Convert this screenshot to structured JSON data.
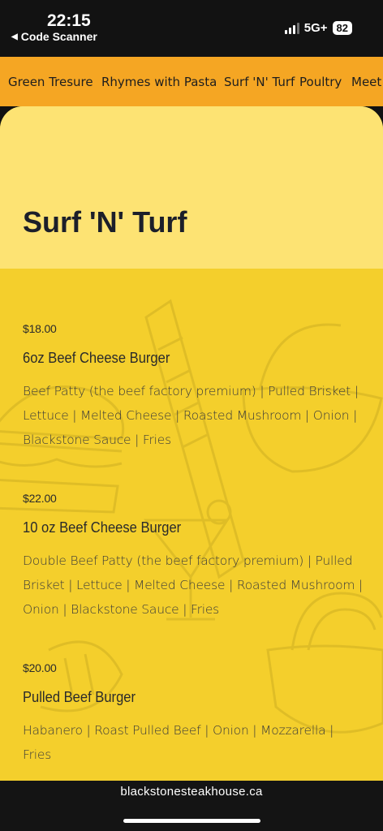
{
  "status_bar": {
    "time": "22:15",
    "back_app": "Code Scanner",
    "network": "5G+",
    "battery": "82"
  },
  "categories": [
    {
      "label": "Green Tresure"
    },
    {
      "label": "Rhymes with Pasta"
    },
    {
      "label": "Surf 'N' Turf"
    },
    {
      "label": "Poultry"
    },
    {
      "label": "Meet"
    }
  ],
  "section": {
    "title": "Surf 'N' Turf"
  },
  "items": [
    {
      "price": "$18.00",
      "name": "6oz Beef Cheese Burger",
      "description": "Beef Patty (the beef factory premium) | Pulled Brisket | Lettuce | Melted Cheese | Roasted Mushroom | Onion | Blackstone Sauce | Fries"
    },
    {
      "price": "$22.00",
      "name": "10 oz Beef Cheese Burger",
      "description": "Double Beef Patty (the beef factory premium) | Pulled Brisket | Lettuce | Melted Cheese | Roasted Mushroom | Onion | Blackstone Sauce | Fries"
    },
    {
      "price": "$20.00",
      "name": "Pulled Beef Burger",
      "description": "Habanero | Roast Pulled Beef | Onion | Mozzarella | Fries"
    }
  ],
  "footer": {
    "url": "blackstonesteakhouse.ca"
  },
  "colors": {
    "nav_bg": "#f5a623",
    "header_bg": "#fde373",
    "card_bg": "#f4cf2c",
    "title": "#1c1f2a"
  }
}
